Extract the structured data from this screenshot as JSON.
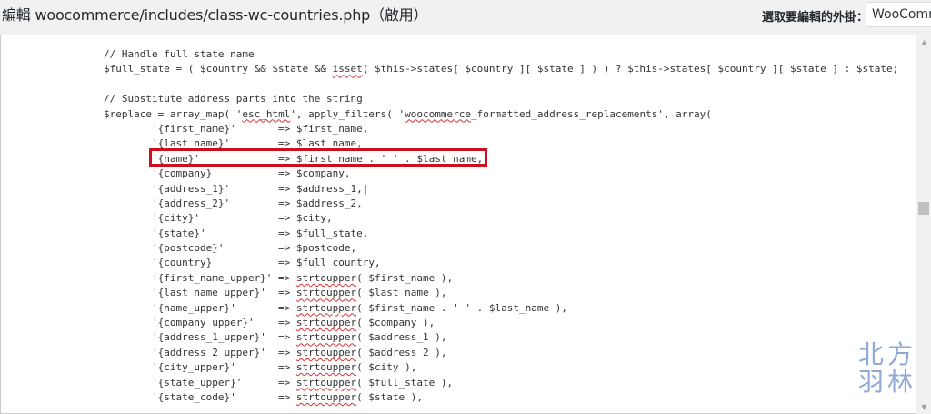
{
  "header": {
    "title": "編輯 woocommerce/includes/class-wc-countries.php（啟用）",
    "select_label": "選取要編輯的外掛：",
    "select_value": "WooCommerce"
  },
  "editor": {
    "lines": [
      {
        "segs": [
          {
            "t": "// Handle full state name"
          }
        ]
      },
      {
        "segs": [
          {
            "t": "$full_state = ( $country && $state && "
          },
          {
            "t": "isset",
            "spell": true
          },
          {
            "t": "( $this->states[ $country ][ $state ] ) ) ? $this->states[ $country ][ $state ] : $state;"
          }
        ]
      },
      {
        "segs": [
          {
            "t": ""
          }
        ]
      },
      {
        "segs": [
          {
            "t": "// Substitute address parts into the string"
          }
        ]
      },
      {
        "segs": [
          {
            "t": "$replace = array_map( '"
          },
          {
            "t": "esc_html",
            "spell": true
          },
          {
            "t": "', apply_filters( '"
          },
          {
            "t": "woocommerce",
            "spell": true
          },
          {
            "t": "_formatted_address_replacements', array("
          }
        ]
      },
      {
        "segs": [
          {
            "t": "        '{first_name}'       => $first_name,"
          }
        ]
      },
      {
        "segs": [
          {
            "t": "        '{last_name}'        => $last_name,"
          }
        ]
      },
      {
        "segs": [
          {
            "t": "        '{name}'             => $first_name . ' ' . $last_name,"
          }
        ]
      },
      {
        "segs": [
          {
            "t": "        '{company}'          => $company,"
          }
        ]
      },
      {
        "segs": [
          {
            "t": "        '{address_1}'        => $address_1,|"
          }
        ]
      },
      {
        "segs": [
          {
            "t": "        '{address_2}'        => $address_2,"
          }
        ]
      },
      {
        "segs": [
          {
            "t": "        '{city}'             => $city,"
          }
        ]
      },
      {
        "segs": [
          {
            "t": "        '{state}'            => $full_state,"
          }
        ]
      },
      {
        "segs": [
          {
            "t": "        '{postcode}'         => $postcode,"
          }
        ]
      },
      {
        "segs": [
          {
            "t": "        '{country}'          => $full_country,"
          }
        ]
      },
      {
        "segs": [
          {
            "t": "        '{first_name_upper}' => "
          },
          {
            "t": "strtoupper",
            "spell": true
          },
          {
            "t": "( $first_name ),"
          }
        ]
      },
      {
        "segs": [
          {
            "t": "        '{last_name_upper}'  => "
          },
          {
            "t": "strtoupper",
            "spell": true
          },
          {
            "t": "( $last_name ),"
          }
        ]
      },
      {
        "segs": [
          {
            "t": "        '{name_upper}'       => "
          },
          {
            "t": "strtoupper",
            "spell": true
          },
          {
            "t": "( $first_name . ' ' . $last_name ),"
          }
        ]
      },
      {
        "segs": [
          {
            "t": "        '{company_upper}'    => "
          },
          {
            "t": "strtoupper",
            "spell": true
          },
          {
            "t": "( $company ),"
          }
        ]
      },
      {
        "segs": [
          {
            "t": "        '{address_1_upper}'  => "
          },
          {
            "t": "strtoupper",
            "spell": true
          },
          {
            "t": "( $address_1 ),"
          }
        ]
      },
      {
        "segs": [
          {
            "t": "        '{address_2_upper}'  => "
          },
          {
            "t": "strtoupper",
            "spell": true
          },
          {
            "t": "( $address_2 ),"
          }
        ]
      },
      {
        "segs": [
          {
            "t": "        '{city_upper}'       => "
          },
          {
            "t": "strtoupper",
            "spell": true
          },
          {
            "t": "( $city ),"
          }
        ]
      },
      {
        "segs": [
          {
            "t": "        '{state_upper}'      => "
          },
          {
            "t": "strtoupper",
            "spell": true
          },
          {
            "t": "( $full_state ),"
          }
        ]
      },
      {
        "segs": [
          {
            "t": "        '{state_code}'       => "
          },
          {
            "t": "strtoupper",
            "spell": true
          },
          {
            "t": "( $state ),"
          }
        ]
      }
    ]
  },
  "watermark": {
    "line1": "北方",
    "line2": "羽林"
  },
  "colors": {
    "highlight_border": "#c8101e",
    "spellcheck_underline": "#d63333",
    "watermark": "#8fa9d4"
  },
  "icons": {
    "scroll_up": "chevron-up-icon",
    "scroll_down": "chevron-down-icon"
  }
}
